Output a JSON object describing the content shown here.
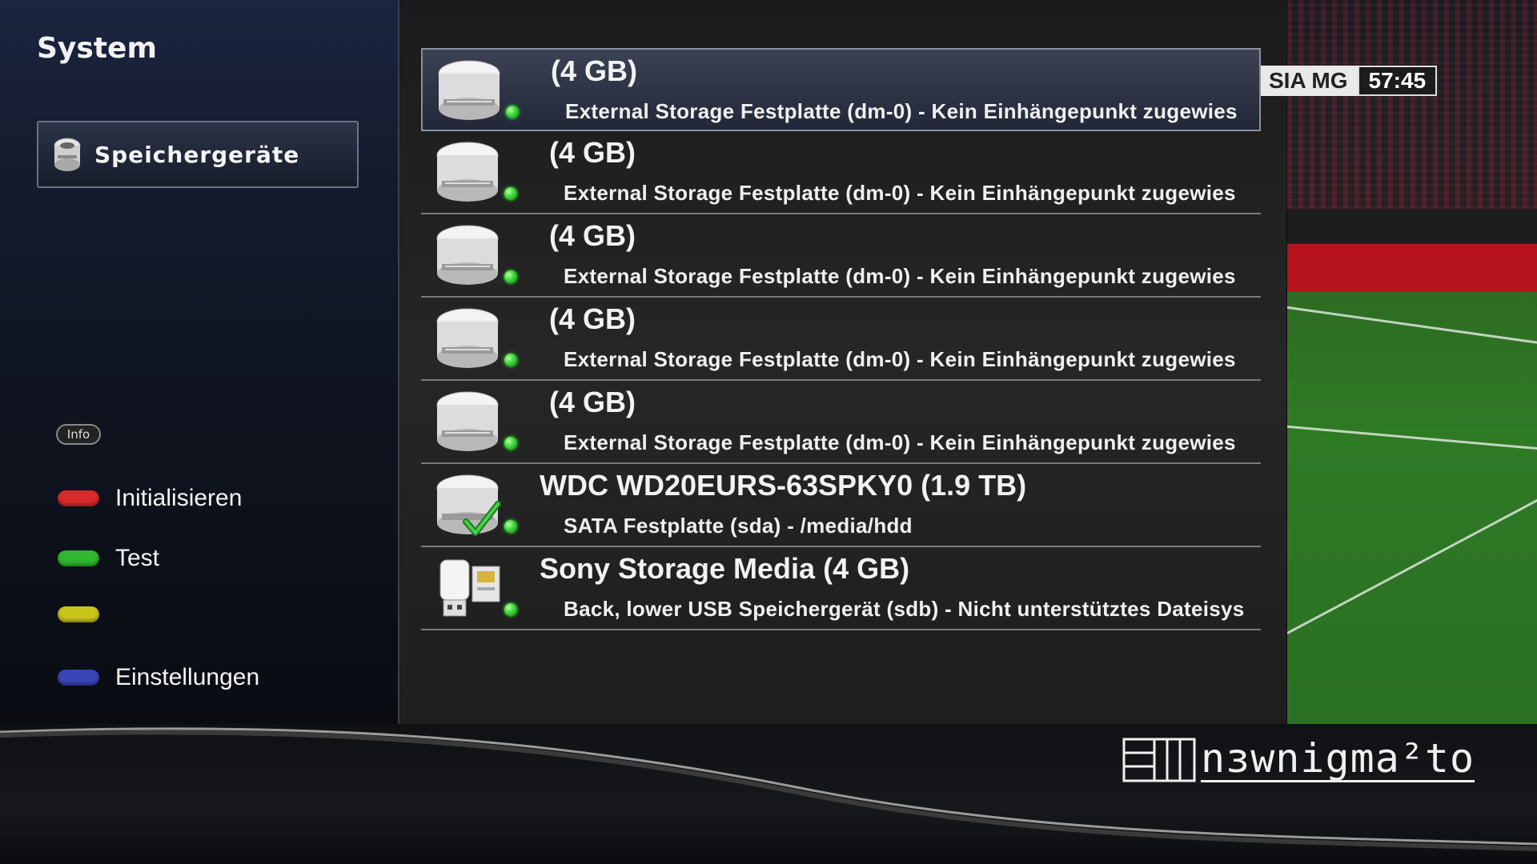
{
  "sidebar": {
    "title": "System",
    "selected_entry": {
      "label": "Speichergeräte",
      "icon": "hard-disk-icon"
    },
    "info_badge": "Info",
    "color_keys": [
      {
        "color_name": "red",
        "color": "#d82a2a",
        "label": "Initialisieren"
      },
      {
        "color_name": "green",
        "color": "#2fb82f",
        "label": "Test"
      },
      {
        "color_name": "yellow",
        "color": "#c9c41c",
        "label": ""
      },
      {
        "color_name": "blue",
        "color": "#3a46b8",
        "label": "Einstellungen"
      }
    ]
  },
  "devices": [
    {
      "name": "(4 GB)",
      "detail": "External Storage Festplatte (dm-0) - Kein Einhängepunkt zugewies",
      "icon": "hard-disk-icon",
      "status": "green",
      "selected": true
    },
    {
      "name": "(4 GB)",
      "detail": "External Storage Festplatte (dm-0) - Kein Einhängepunkt zugewies",
      "icon": "hard-disk-icon",
      "status": "green",
      "selected": false
    },
    {
      "name": "(4 GB)",
      "detail": "External Storage Festplatte (dm-0) - Kein Einhängepunkt zugewies",
      "icon": "hard-disk-icon",
      "status": "green",
      "selected": false
    },
    {
      "name": "(4 GB)",
      "detail": "External Storage Festplatte (dm-0) - Kein Einhängepunkt zugewies",
      "icon": "hard-disk-icon",
      "status": "green",
      "selected": false
    },
    {
      "name": "(4 GB)",
      "detail": "External Storage Festplatte (dm-0) - Kein Einhängepunkt zugewies",
      "icon": "hard-disk-icon",
      "status": "green",
      "selected": false
    },
    {
      "name": "WDC WD20EURS-63SPKY0 (1.9 TB)",
      "detail": "SATA Festplatte (sda) - /media/hdd",
      "icon": "hard-disk-mounted-icon",
      "status": "green",
      "selected": false
    },
    {
      "name": "Sony Storage Media (4 GB)",
      "detail": "Back, lower USB Speichergerät (sdb) - Nicht unterstütztes Dateisys",
      "icon": "usb-stick-icon",
      "status": "green",
      "selected": false
    }
  ],
  "tv_preview": {
    "score_team": "SIA MG",
    "match_time": "57:45"
  },
  "branding": {
    "logo_text": "nɜwnigma²to"
  },
  "colors": {
    "status_ok": "#3cd63c",
    "selection": "#2e3546"
  }
}
